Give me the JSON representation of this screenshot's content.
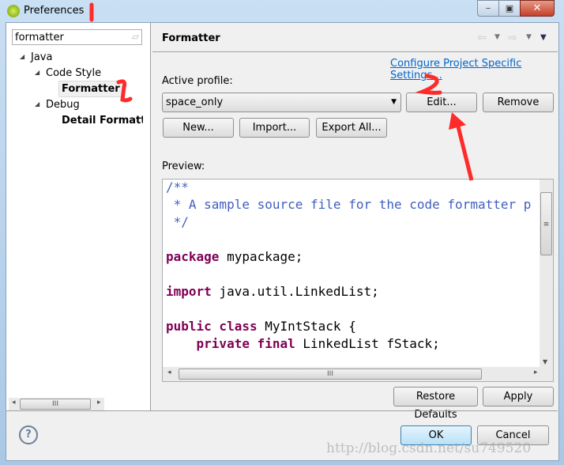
{
  "window": {
    "title": "Preferences",
    "controls": {
      "minimize": "minimize",
      "maximize": "maximize",
      "close": "close"
    }
  },
  "sidebar": {
    "filter_value": "formatter",
    "tree": [
      {
        "label": "Java"
      },
      {
        "label": "Code Style"
      },
      {
        "label": "Formatter",
        "selected": true
      },
      {
        "label": "Debug"
      },
      {
        "label": "Detail Formatters"
      }
    ]
  },
  "page": {
    "title": "Formatter",
    "link": "Configure Project Specific Settings...",
    "active_profile_label": "Active profile:",
    "profile_value": "space_only",
    "buttons": {
      "edit": "Edit...",
      "remove": "Remove",
      "new": "New...",
      "import": "Import...",
      "export_all": "Export All..."
    },
    "preview_label": "Preview:",
    "code": {
      "l1": "/**",
      "l2": " * A sample source file for the code formatter p",
      "l3": " */",
      "l4_kw": "package",
      "l4": " mypackage;",
      "l5_kw": "import",
      "l5": " java.util.LinkedList;",
      "l6_kw": "public class",
      "l6": " MyIntStack {",
      "l7_kw": "    private final",
      "l7": " LinkedList fStack;"
    },
    "restore_defaults": "Restore Defaults",
    "apply": "Apply"
  },
  "footer": {
    "ok": "OK",
    "cancel": "Cancel",
    "help_icon": "help-icon"
  },
  "watermark": "http://blog.csdn.net/su749520",
  "annotations": {
    "mark1": "1",
    "mark2": "2",
    "color": "#ff2a2a"
  }
}
